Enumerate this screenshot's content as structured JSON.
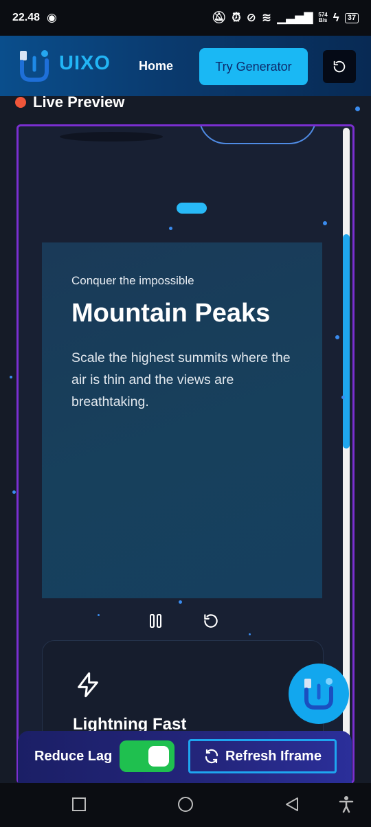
{
  "status_bar": {
    "time": "22.48",
    "net_speed_value": "574",
    "net_speed_unit": "B/s",
    "battery": "37"
  },
  "header": {
    "brand": "UIXO",
    "nav_home": "Home",
    "try_button": "Try Generator"
  },
  "preview": {
    "label": "Live Preview",
    "hero": {
      "subtitle": "Conquer the impossible",
      "title": "Mountain Peaks",
      "description": "Scale the highest summits where the air is thin and the views are breathtaking."
    },
    "feature": {
      "title": "Lightning Fast"
    }
  },
  "controls": {
    "reduce_lag_label": "Reduce Lag",
    "reduce_lag_on": true,
    "refresh_button": "Refresh Iframe"
  },
  "colors": {
    "accent": "#1ab8f4",
    "frame_border": "#7a2fd0",
    "live_dot": "#f0563a",
    "toggle_on": "#1fc04f"
  },
  "icons": [
    "screen-record-icon",
    "mute-icon",
    "alarm-icon",
    "dnd-icon",
    "wifi-icon",
    "signal-icon",
    "battery-icon",
    "history-icon",
    "pause-icon",
    "restart-icon",
    "bolt-icon",
    "refresh-icon",
    "square-nav-icon",
    "home-nav-icon",
    "back-nav-icon",
    "accessibility-icon"
  ]
}
